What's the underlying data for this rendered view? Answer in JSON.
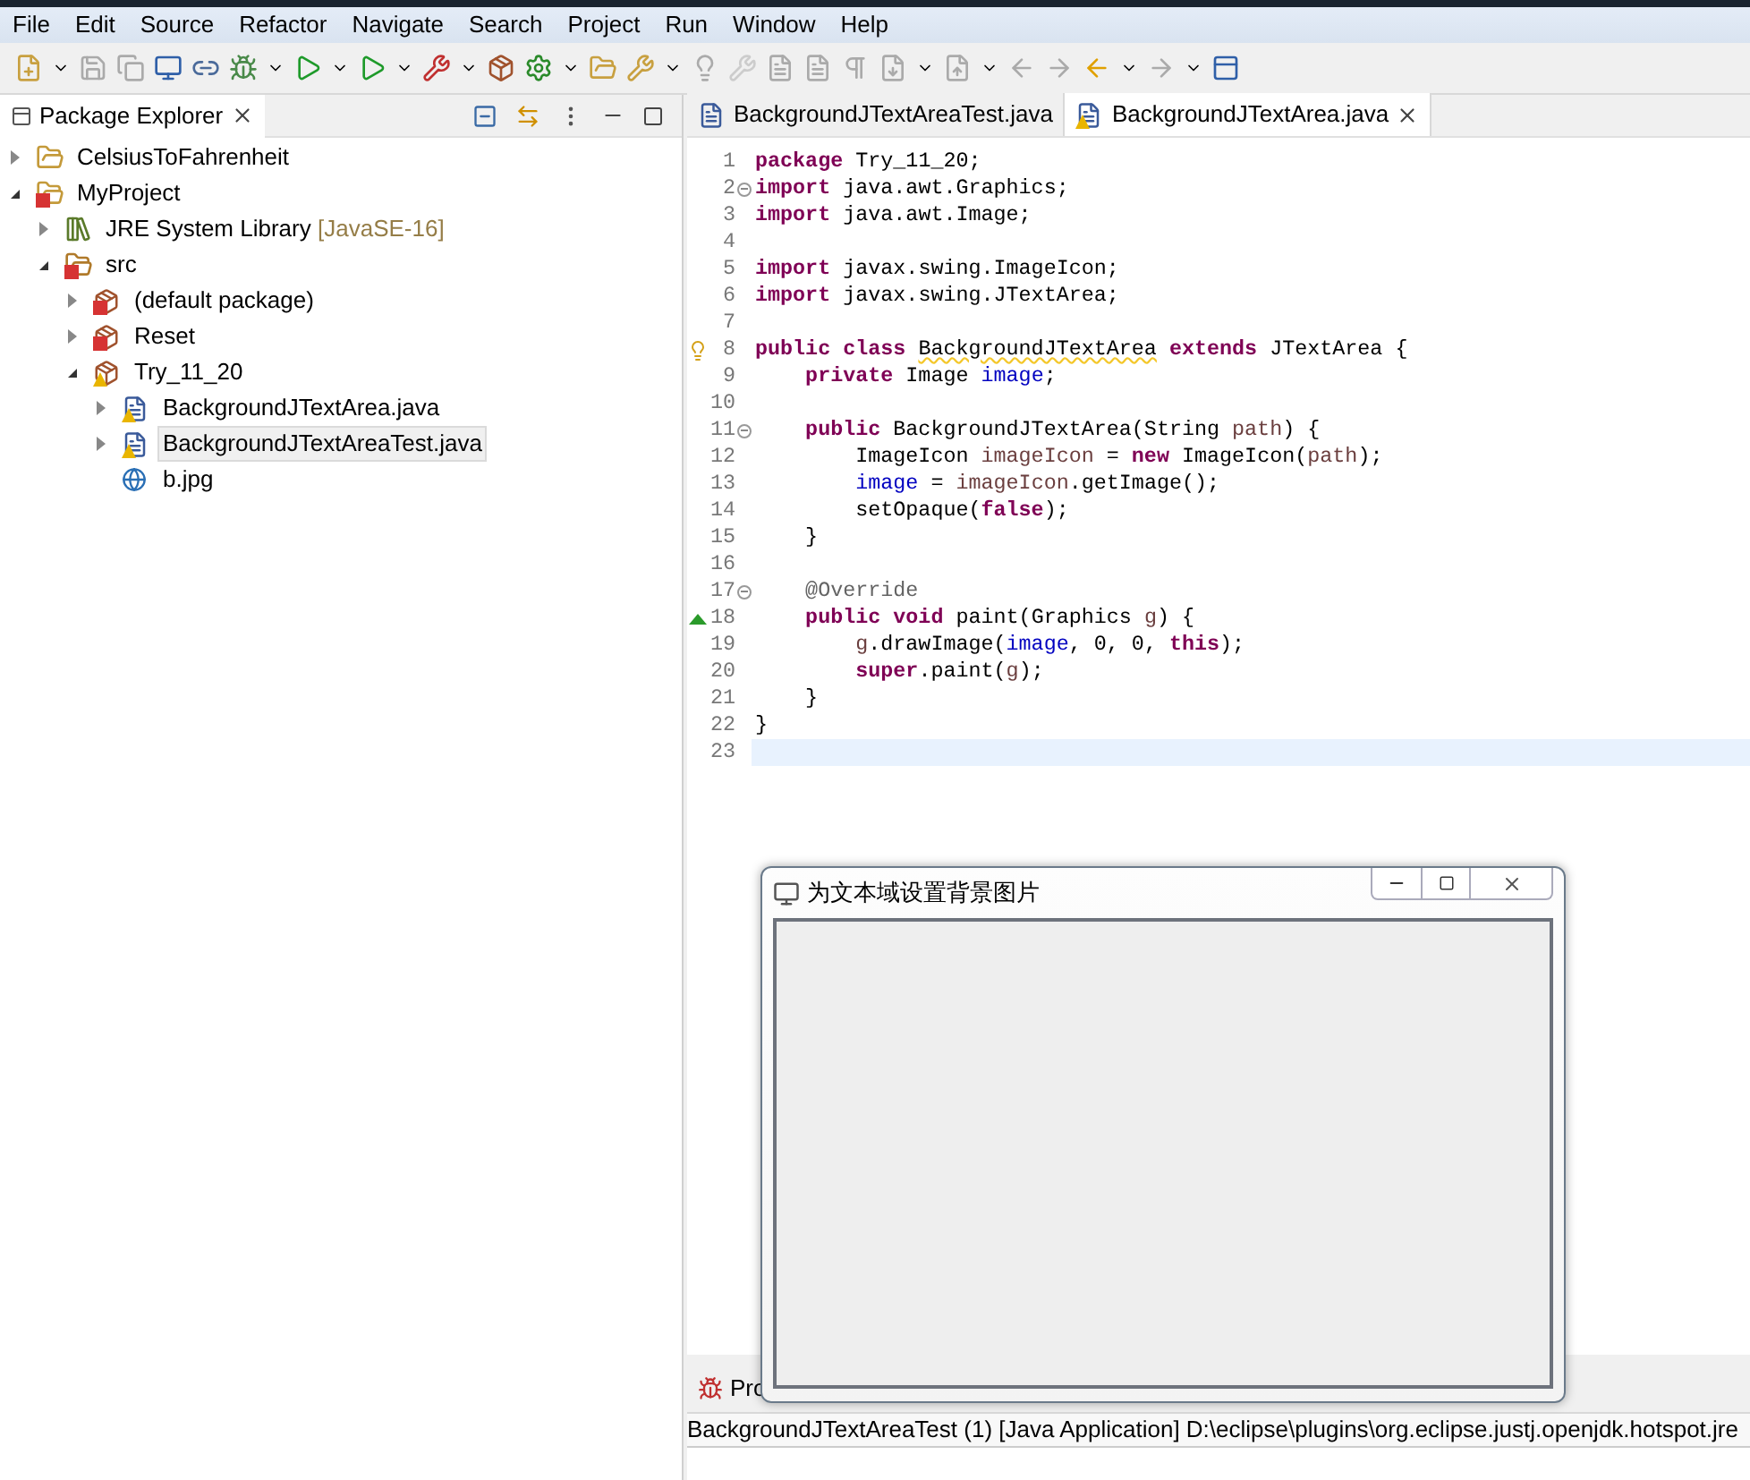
{
  "menu_bar": [
    "File",
    "Edit",
    "Source",
    "Refactor",
    "Navigate",
    "Search",
    "Project",
    "Run",
    "Window",
    "Help"
  ],
  "package_explorer": {
    "title": "Package Explorer",
    "selected": true,
    "tree": [
      {
        "label": "CelsiusToFahrenheit",
        "kind": "project",
        "expanded": false,
        "selected": false
      },
      {
        "label": "MyProject",
        "kind": "project",
        "has_error": true,
        "expanded": true,
        "selected": false,
        "children": [
          {
            "label": "JRE System Library",
            "decoration": "[JavaSE-16]",
            "kind": "library",
            "expanded": false,
            "selected": false
          },
          {
            "label": "src",
            "kind": "source-folder",
            "has_error": true,
            "expanded": true,
            "selected": false,
            "children": [
              {
                "label": "(default package)",
                "kind": "package",
                "has_error": true,
                "expanded": false,
                "selected": false
              },
              {
                "label": "Reset",
                "kind": "package",
                "has_error": true,
                "expanded": false,
                "selected": false
              },
              {
                "label": "Try_11_20",
                "kind": "package",
                "has_warning": true,
                "expanded": true,
                "selected": false,
                "children": [
                  {
                    "label": "BackgroundJTextArea.java",
                    "kind": "java-file",
                    "has_warning": true,
                    "expanded": false,
                    "selected": false
                  },
                  {
                    "label": "BackgroundJTextAreaTest.java",
                    "kind": "java-file",
                    "has_warning": true,
                    "expanded": false,
                    "selected": true
                  },
                  {
                    "label": "b.jpg",
                    "kind": "image-file",
                    "selected": false
                  }
                ]
              }
            ]
          }
        ]
      }
    ]
  },
  "editor": {
    "tabs": [
      {
        "label": "BackgroundJTextAreaTest.java",
        "selected": false
      },
      {
        "label": "BackgroundJTextArea.java",
        "selected": true,
        "has_warning": true
      }
    ],
    "lines": [
      {
        "number": "1",
        "tokens": [
          {
            "kind": "keyword",
            "text": "package"
          },
          {
            "kind": "plain",
            "text": " Try_11_20;"
          }
        ]
      },
      {
        "number": "2",
        "foldable": true,
        "tokens": [
          {
            "kind": "keyword",
            "text": "import"
          },
          {
            "kind": "plain",
            "text": " java.awt.Graphics;"
          }
        ]
      },
      {
        "number": "3",
        "tokens": [
          {
            "kind": "keyword",
            "text": "import"
          },
          {
            "kind": "plain",
            "text": " java.awt.Image;"
          }
        ]
      },
      {
        "number": "4"
      },
      {
        "number": "5",
        "tokens": [
          {
            "kind": "keyword",
            "text": "import"
          },
          {
            "kind": "plain",
            "text": " javax.swing.ImageIcon;"
          }
        ]
      },
      {
        "number": "6",
        "tokens": [
          {
            "kind": "keyword",
            "text": "import"
          },
          {
            "kind": "plain",
            "text": " javax.swing.JTextArea;"
          }
        ]
      },
      {
        "number": "7"
      },
      {
        "number": "8",
        "warning": true,
        "tokens": [
          {
            "kind": "keyword",
            "text": "public class "
          },
          {
            "kind": "warning",
            "text": "BackgroundJTextArea"
          },
          {
            "kind": "keyword",
            "text": " extends"
          },
          {
            "kind": "plain",
            "text": " JTextArea {"
          }
        ]
      },
      {
        "number": "9",
        "tokens": [
          {
            "kind": "keyword",
            "text": "    private"
          },
          {
            "kind": "plain",
            "text": " Image "
          },
          {
            "kind": "field",
            "text": "image"
          },
          {
            "kind": "plain",
            "text": ";"
          }
        ]
      },
      {
        "number": "10"
      },
      {
        "number": "11",
        "foldable": true,
        "tokens": [
          {
            "kind": "keyword",
            "text": "    public"
          },
          {
            "kind": "plain",
            "text": " BackgroundJTextArea(String "
          },
          {
            "kind": "local",
            "text": "path"
          },
          {
            "kind": "plain",
            "text": ") {"
          }
        ]
      },
      {
        "number": "12",
        "tokens": [
          {
            "kind": "plain",
            "text": "        ImageIcon "
          },
          {
            "kind": "local",
            "text": "imageIcon"
          },
          {
            "kind": "plain",
            "text": " = "
          },
          {
            "kind": "keyword",
            "text": "new"
          },
          {
            "kind": "plain",
            "text": " ImageIcon("
          },
          {
            "kind": "local",
            "text": "path"
          },
          {
            "kind": "plain",
            "text": ");"
          }
        ]
      },
      {
        "number": "13",
        "tokens": [
          {
            "kind": "field",
            "text": "        image"
          },
          {
            "kind": "plain",
            "text": " = "
          },
          {
            "kind": "local",
            "text": "imageIcon"
          },
          {
            "kind": "plain",
            "text": ".getImage();"
          }
        ]
      },
      {
        "number": "14",
        "tokens": [
          {
            "kind": "plain",
            "text": "        setOpaque("
          },
          {
            "kind": "keyword",
            "text": "false"
          },
          {
            "kind": "plain",
            "text": ");"
          }
        ]
      },
      {
        "number": "15",
        "tokens": [
          {
            "kind": "plain",
            "text": "    }"
          }
        ]
      },
      {
        "number": "16"
      },
      {
        "number": "17",
        "foldable": true,
        "tokens": [
          {
            "kind": "annotation",
            "text": "    @Override"
          }
        ]
      },
      {
        "number": "18",
        "override": true,
        "tokens": [
          {
            "kind": "keyword",
            "text": "    public void"
          },
          {
            "kind": "plain",
            "text": " paint(Graphics "
          },
          {
            "kind": "local",
            "text": "g"
          },
          {
            "kind": "plain",
            "text": ") {"
          }
        ]
      },
      {
        "number": "19",
        "tokens": [
          {
            "kind": "local",
            "text": "        g"
          },
          {
            "kind": "plain",
            "text": ".drawImage("
          },
          {
            "kind": "field",
            "text": "image"
          },
          {
            "kind": "plain",
            "text": ", 0, 0, "
          },
          {
            "kind": "keyword",
            "text": "this"
          },
          {
            "kind": "plain",
            "text": ");"
          }
        ]
      },
      {
        "number": "20",
        "tokens": [
          {
            "kind": "keyword",
            "text": "        super"
          },
          {
            "kind": "plain",
            "text": ".paint("
          },
          {
            "kind": "local",
            "text": "g"
          },
          {
            "kind": "plain",
            "text": ");"
          }
        ]
      },
      {
        "number": "21",
        "tokens": [
          {
            "kind": "plain",
            "text": "    }"
          }
        ]
      },
      {
        "number": "22",
        "tokens": [
          {
            "kind": "plain",
            "text": "}"
          }
        ]
      },
      {
        "number": "23",
        "current": true
      }
    ]
  },
  "bottom_panel": {
    "tab": "Pro",
    "console_line": "BackgroundJTextAreaTest (1) [Java Application] D:\\eclipse\\plugins\\org.eclipse.justj.openjdk.hotspot.jre"
  },
  "app_window": {
    "title": "为文本域设置背景图片"
  }
}
